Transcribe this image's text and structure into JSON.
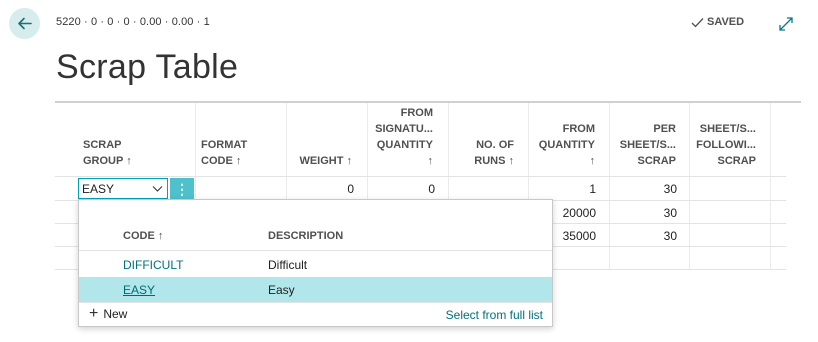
{
  "header": {
    "record_key": "5220 · 0 · 0 · 0 · 0.00 · 0.00 · 1",
    "saved_label": "SAVED",
    "title": "Scrap Table"
  },
  "columns": [
    {
      "label": "SCRAP GROUP ↑"
    },
    {
      "label": "FORMAT CODE ↑"
    },
    {
      "label": "WEIGHT ↑"
    },
    {
      "label": "FROM SIGNATU... QUANTITY ↑"
    },
    {
      "label": "NO. OF RUNS ↑"
    },
    {
      "label": "FROM QUANTITY ↑"
    },
    {
      "label": "PER SHEET/S... SCRAP"
    },
    {
      "label": "SHEET/S... FOLLOWI... SCRAP"
    }
  ],
  "header_lines": {
    "scrap_group": [
      "SCRAP",
      "GROUP ↑"
    ],
    "format_code": [
      "FORMAT",
      "CODE ↑"
    ],
    "weight": [
      "WEIGHT ↑"
    ],
    "from_sig": [
      "FROM",
      "SIGNATU...",
      "QUANTITY",
      "↑"
    ],
    "no_runs": [
      "NO. OF",
      "RUNS ↑"
    ],
    "from_qty": [
      "FROM",
      "QUANTITY",
      "↑"
    ],
    "per_sheet": [
      "PER",
      "SHEET/S...",
      "SCRAP"
    ],
    "sheet_follow": [
      "SHEET/S...",
      "FOLLOWI...",
      "SCRAP"
    ]
  },
  "rows": [
    {
      "scrap_group": "EASY",
      "weight": "0",
      "from_sig": "0",
      "from_qty": "1",
      "per_sheet": "30"
    },
    {
      "from_qty": "20000",
      "per_sheet": "30"
    },
    {
      "from_qty": "35000",
      "per_sheet": "30"
    }
  ],
  "dropdown": {
    "code_header": "CODE ↑",
    "desc_header": "DESCRIPTION",
    "items": [
      {
        "code": "DIFFICULT",
        "description": "Difficult"
      },
      {
        "code": "EASY",
        "description": "Easy"
      }
    ],
    "new_label": "New",
    "full_list_label": "Select from full list"
  },
  "colors": {
    "accent": "#00a4b4",
    "selected_row": "#b1e7ea",
    "link": "#00727c",
    "back_button_bg": "#d6eced"
  },
  "icons": [
    "back-arrow-icon",
    "checkmark-icon",
    "expand-icon",
    "chevron-down-icon",
    "more-options-icon",
    "plus-icon"
  ]
}
